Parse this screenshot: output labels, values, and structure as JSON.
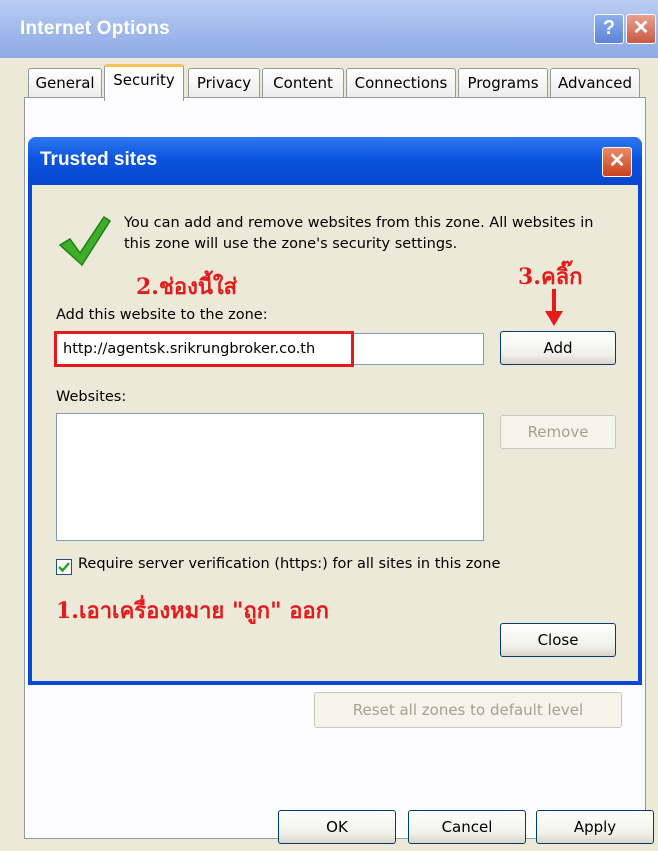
{
  "window": {
    "title": "Internet Options",
    "help_glyph": "?",
    "close_glyph": "✕",
    "tabs": [
      "General",
      "Security",
      "Privacy",
      "Content",
      "Connections",
      "Programs",
      "Advanced"
    ],
    "active_tab": "Security",
    "reset_all_label": "Reset all zones to default level",
    "ok_label": "OK",
    "cancel_label": "Cancel",
    "apply_label": "Apply"
  },
  "dialog": {
    "title": "Trusted sites",
    "close_glyph": "✕",
    "info_text": "You can add and remove websites from this zone. All websites in this zone will use the zone's security settings.",
    "add_label": "Add this website to the zone:",
    "website_value": "http://agentsk.srikrungbroker.co.th",
    "add_button": "Add",
    "websites_label": "Websites:",
    "remove_button": "Remove",
    "require_https_label": "Require server verification (https:) for all sites in this zone",
    "require_https_checked": true,
    "close_button": "Close"
  },
  "annotations": {
    "step2": "2.ช่องนี้ใส่",
    "step3": "3.คลิ๊ก",
    "step1": "1.เอาเครื่องหมาย \"ถูก\" ออก"
  },
  "colors": {
    "annotation": "#e31b1b",
    "dialog_title": "#0b55de",
    "window_title": "#9db6ea"
  }
}
